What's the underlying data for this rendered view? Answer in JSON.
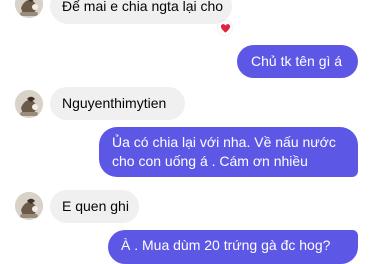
{
  "messages": [
    {
      "sender": "other",
      "text": "Để mai e chia ngta lại cho",
      "reaction": "heart"
    },
    {
      "sender": "me",
      "text": "Chủ tk tên gì á"
    },
    {
      "sender": "other",
      "text": "Nguyenthimytien"
    },
    {
      "sender": "me",
      "lines": [
        "Ủa có chia lại với nha. Về nấu nước",
        "cho con uống á . Cám ơn nhiều"
      ]
    },
    {
      "sender": "other",
      "text": "E quen ghi"
    },
    {
      "sender": "me",
      "text": "À . Mua dùm 20 trứng gà đc hog?"
    }
  ],
  "colors": {
    "outgoing_bubble": "#5d57e6",
    "incoming_bubble": "#f0f0f0",
    "reaction_heart": "#e0213f"
  },
  "icons": {
    "reaction": "heart-icon",
    "avatar": "contact-avatar"
  }
}
